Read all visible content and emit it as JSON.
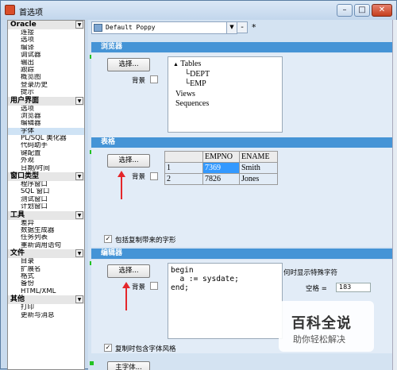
{
  "window": {
    "title": "首选项"
  },
  "left_panel": {
    "groups": [
      {
        "title": "Oracle",
        "items": [
          "连接",
          "选项",
          "编译",
          "调试器",
          "输出",
          "跟踪",
          "概览图",
          "登录历史",
          "提示"
        ]
      },
      {
        "title": "用户界面",
        "items": [
          "选项",
          "浏览器",
          "编辑器",
          "字体",
          "PL/SQL 美化器",
          "代码助手",
          "键配置",
          "外观",
          "日期/时间"
        ],
        "selected": "字体"
      },
      {
        "title": "窗口类型",
        "items": [
          "程序窗口",
          "SQL 窗口",
          "测试窗口",
          "计划窗口"
        ]
      },
      {
        "title": "工具",
        "items": [
          "差异",
          "数据生成器",
          "任务列表",
          "重新调用语句"
        ]
      },
      {
        "title": "文件",
        "items": [
          "目录",
          "扩展名",
          "格式",
          "备份",
          "HTML/XML"
        ]
      },
      {
        "title": "其他",
        "items": [
          "打印",
          "更新与消息"
        ]
      }
    ]
  },
  "toolbar": {
    "profile": "Default Poppy",
    "minus": "-",
    "star": "*"
  },
  "browser": {
    "header": "浏览器",
    "select_button": "选择...",
    "background_label": "背景",
    "tree": {
      "root": "Tables",
      "children": [
        "DEPT",
        "EMP"
      ],
      "siblings": [
        "Views",
        "Sequences"
      ]
    }
  },
  "grid": {
    "header": "表格",
    "select_button": "选择...",
    "background_label": "背景",
    "columns": [
      "EMPNO",
      "ENAME"
    ],
    "rows": [
      [
        "1",
        "7369",
        "Smith"
      ],
      [
        "2",
        "7826",
        "Jones"
      ]
    ]
  },
  "options": {
    "include_chars": "包括复制带来的字形"
  },
  "editor": {
    "header": "编辑器",
    "select_button": "选择...",
    "background_label": "背景",
    "code": "begin\n  a := sysdate;\nend;",
    "special_chars_label": "何时显示特殊字符",
    "space_label": "空格 =",
    "space_value": "183",
    "copy_style_label": "复制时包含字体风格",
    "main_font_button": "主字体..."
  },
  "watermark": {
    "line1": "百科全说",
    "line2": "助你轻松解决"
  }
}
